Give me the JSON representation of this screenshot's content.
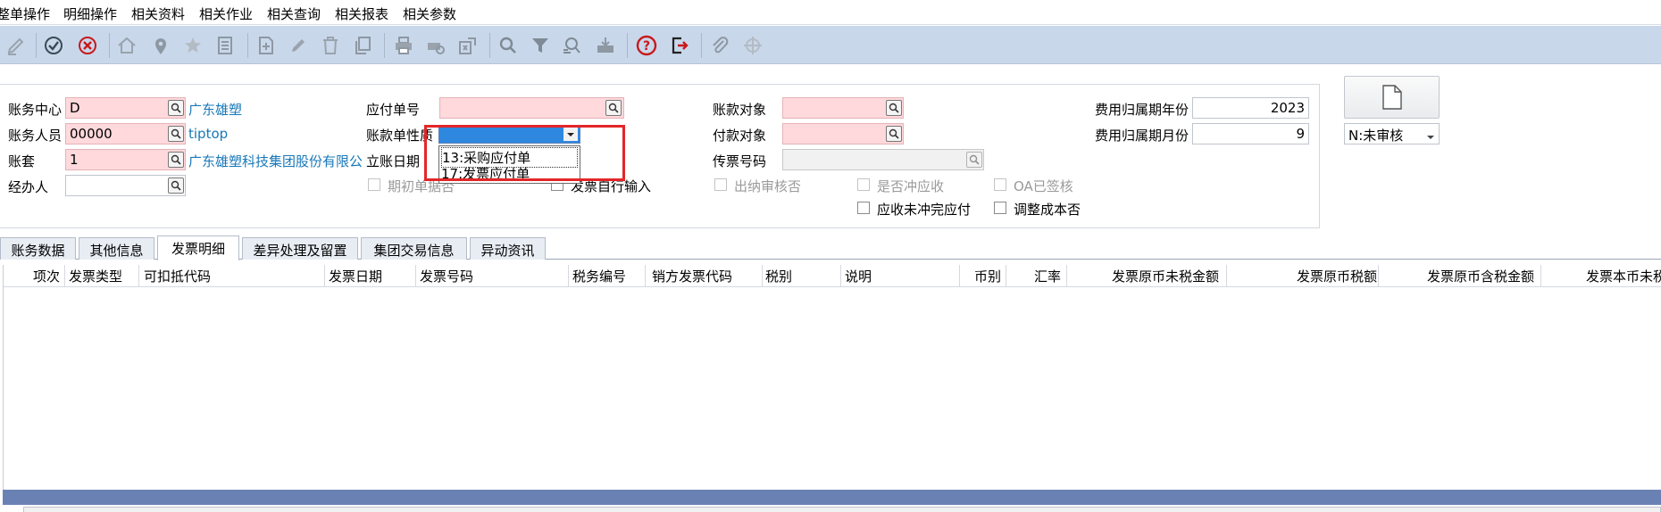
{
  "menu": [
    "整单操作",
    "明细操作",
    "相关资料",
    "相关作业",
    "相关查询",
    "相关报表",
    "相关参数"
  ],
  "toolbar_icons": [
    "edit-icon",
    "confirm-icon",
    "cancel-icon",
    "home-icon",
    "location-icon",
    "favorite-icon",
    "list-icon",
    "add-icon",
    "modify-icon",
    "delete-icon",
    "copy-icon",
    "print-icon",
    "print-preview-icon",
    "export-icon",
    "query-icon",
    "filter-icon",
    "advanced-query-icon",
    "download-icon",
    "help-icon",
    "exit-icon",
    "attachment-icon",
    "locate-icon"
  ],
  "form": {
    "center_label": "账务中心",
    "center_value": "D",
    "center_name": "广东雄塑",
    "person_label": "账务人员",
    "person_value": "00000",
    "person_name": "tiptop",
    "book_label": "账套",
    "book_value": "1",
    "book_name": "广东雄塑科技集团股份有限公",
    "handler_label": "经办人",
    "handler_value": "",
    "ap_no_label": "应付单号",
    "ap_no_value": "",
    "nature_label": "账款单性质",
    "nature_value": "",
    "date_label": "立账日期",
    "payee_label": "账款对象",
    "payee_value": "",
    "pay_to_label": "付款对象",
    "pay_to_value": "",
    "voucher_label": "传票号码",
    "voucher_value": "",
    "year_label": "费用归属期年份",
    "year_value": "2023",
    "month_label": "费用归属期月份",
    "month_value": "9",
    "status_value": "N:未审核"
  },
  "dropdown": [
    "13:采购应付单",
    "17:发票应付单"
  ],
  "checks": {
    "opening": "期初单据否",
    "invoice_self": "发票自行输入",
    "cashier": "出纳审核否",
    "offset": "是否冲应收",
    "oa": "OA已签核",
    "unpaid": "应收未冲完应付",
    "adjust_cost": "调整成本否"
  },
  "tabs": [
    "账务数据",
    "其他信息",
    "发票明细",
    "差异处理及留置",
    "集团交易信息",
    "异动资讯"
  ],
  "grid_headers": [
    "项次",
    "发票类型",
    "可扣抵代码",
    "发票日期",
    "发票号码",
    "税务编号",
    "销方发票代码",
    "税别",
    "说明",
    "币别",
    "汇率",
    "发票原币未税金额",
    "发票原币税额",
    "发票原币含税金额",
    "发票本币未税"
  ],
  "colors": {
    "toolbar": "#c9d7ea",
    "required_field": "#ffd9dc",
    "link": "#1878b8",
    "highlight": "#e32629",
    "grid_bar": "#6a82b3"
  }
}
